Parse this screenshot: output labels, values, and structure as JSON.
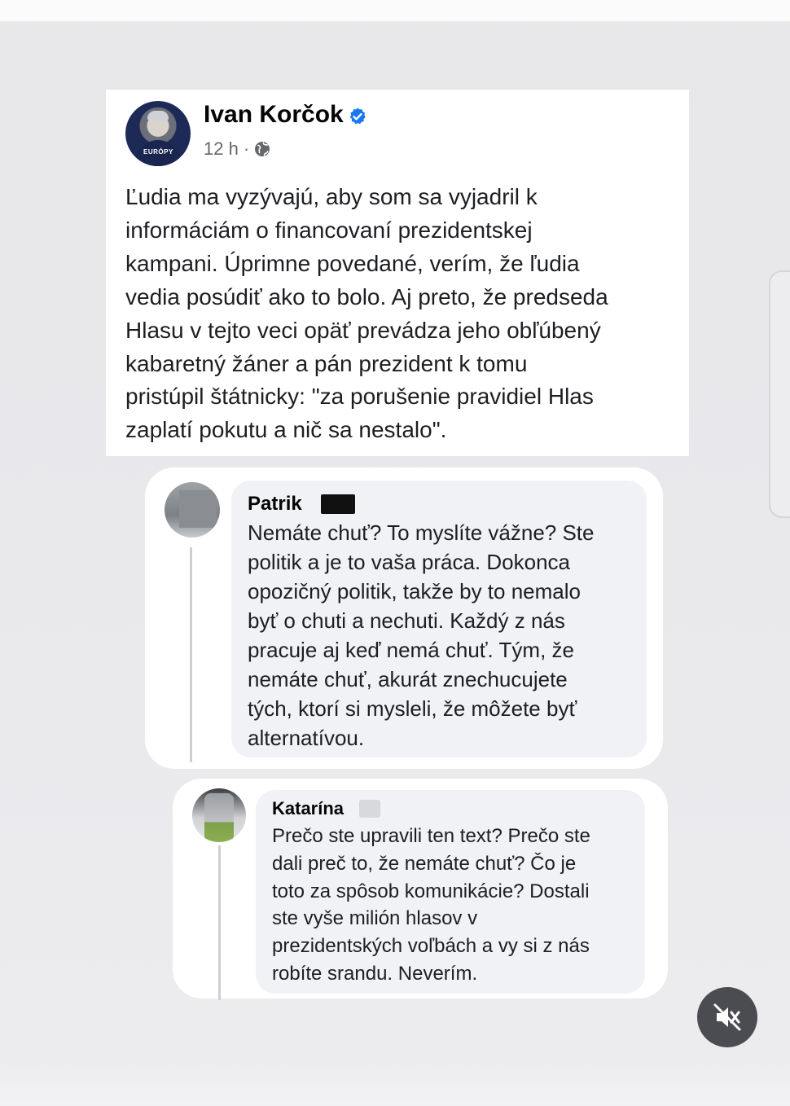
{
  "post": {
    "author": "Ivan Korčok",
    "time": "12 h",
    "separator": "·",
    "avatar_badge": "EURÓPY",
    "text": "Ľudia ma vyzývajú, aby som sa vyjadril k\ninformáciám o financovaní prezidentskej\nkampani. Úprimne povedané, verím, že ľudia\nvedia posúdiť ako to bolo. Aj preto, že predseda\nHlasu  v tejto veci opäť prevádza jeho obľúbený\nkabaretný žáner a pán prezident k tomu\npristúpil štátnicky: \"za porušenie pravidiel Hlas\nzaplatí pokutu a nič sa nestalo\"."
  },
  "comments": [
    {
      "name": "Patrik",
      "text": "Nemáte chuť? To myslíte vážne? Ste\npolitik a je to vaša práca. Dokonca\nopozičný politik, takže by to nemalo\nbyť o chuti a nechuti. Každý z nás\npracuje aj keď nemá chuť. Tým, že\nnemáte chuť, akurát znechucujete\ntých, ktorí si mysleli, že môžete byť\nalternatívou."
    },
    {
      "name": "Katarína",
      "text": "Prečo ste upravili ten text? Prečo ste\ndali preč to, že nemáte chuť? Čo je\ntoto za spôsob komunikácie? Dostali\nste vyše milión hlasov v\nprezidentských voľbách a vy si z nás\nrobíte srandu. Neverím."
    }
  ],
  "icons": {
    "verified": "verified-badge-icon",
    "audience": "globe-icon",
    "mute": "speaker-muted-icon"
  },
  "colors": {
    "verified_blue": "#1877f2",
    "bubble_bg": "#f0f2f5",
    "meta_gray": "#65676b"
  }
}
